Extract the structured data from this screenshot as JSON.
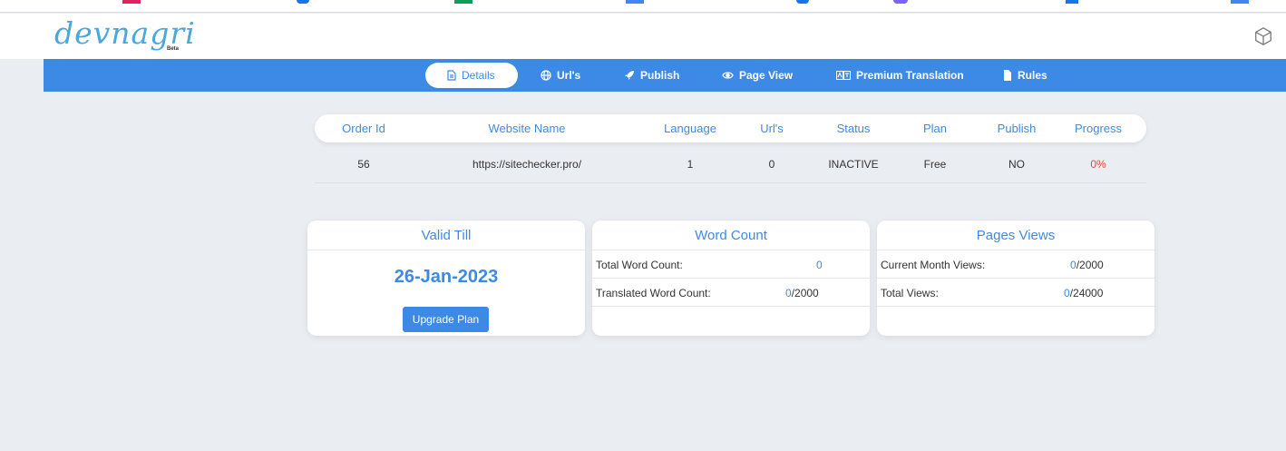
{
  "colors": {
    "accent": "#3d8ae6",
    "logo": "#4aa8df",
    "danger": "#e84545",
    "background": "#eaedf1"
  },
  "header": {
    "logo_text": "devnagri",
    "logo_badge": "Beta",
    "right_icon": "cube-icon"
  },
  "nav": {
    "tabs": [
      {
        "label": "Details",
        "icon": "document-icon",
        "active": true
      },
      {
        "label": "Url's",
        "icon": "globe-icon",
        "active": false
      },
      {
        "label": "Publish",
        "icon": "rocket-icon",
        "active": false
      },
      {
        "label": "Page View",
        "icon": "eye-icon",
        "active": false
      },
      {
        "label": "Premium Translation",
        "icon": "translate-icon",
        "active": false
      },
      {
        "label": "Rules",
        "icon": "file-icon",
        "active": false
      }
    ]
  },
  "order_table": {
    "columns": [
      "Order Id",
      "Website Name",
      "Language",
      "Url's",
      "Status",
      "Plan",
      "Publish",
      "Progress"
    ],
    "rows": [
      [
        "56",
        "https://sitechecker.pro/",
        "1",
        "0",
        "INACTIVE",
        "Free",
        "NO",
        "0%"
      ]
    ]
  },
  "valid_card": {
    "title": "Valid Till",
    "date": "26-Jan-2023",
    "button": "Upgrade Plan"
  },
  "word_card": {
    "title": "Word Count",
    "rows": [
      {
        "label": "Total Word Count:",
        "used": "0",
        "limit": ""
      },
      {
        "label": "Translated Word Count:",
        "used": "0",
        "limit": "/2000"
      }
    ]
  },
  "views_card": {
    "title": "Pages Views",
    "rows": [
      {
        "label": "Current Month Views:",
        "used": "0",
        "limit": "/2000"
      },
      {
        "label": "Total Views:",
        "used": "0",
        "limit": "/24000"
      }
    ]
  }
}
